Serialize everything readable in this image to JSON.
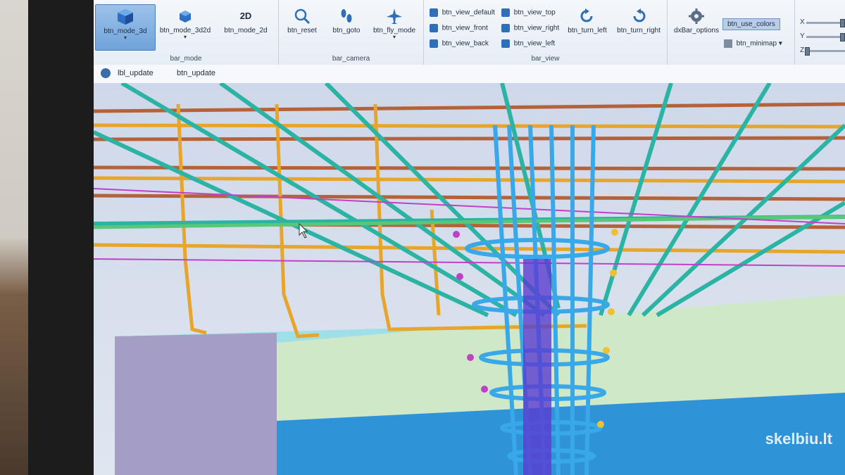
{
  "ribbon": {
    "bar_mode": {
      "label": "bar_mode",
      "buttons": [
        {
          "label": "btn_mode_3d",
          "icon": "cube-icon"
        },
        {
          "label": "btn_mode_3d2d",
          "icon": "cube-small-icon"
        },
        {
          "label": "btn_mode_2d",
          "icon": "2d-icon",
          "icon_text": "2D"
        }
      ]
    },
    "bar_camera": {
      "label": "bar_camera",
      "buttons": [
        {
          "label": "btn_reset",
          "icon": "magnifier-icon"
        },
        {
          "label": "btn_goto",
          "icon": "footprints-icon"
        },
        {
          "label": "btn_fly_mode",
          "icon": "airplane-icon"
        }
      ]
    },
    "bar_view": {
      "label": "bar_view",
      "buttons_left": [
        "btn_view_default",
        "btn_view_front",
        "btn_view_back"
      ],
      "buttons_mid": [
        "btn_view_top",
        "btn_view_right",
        "btn_view_left"
      ],
      "turn_left": "btn_turn_left",
      "turn_right": "btn_turn_right"
    },
    "options": {
      "options_label": "dxBar_options",
      "use_colors": "btn_use_colors",
      "minimap": "btn_minimap"
    },
    "axes": [
      "X",
      "Y",
      "Z"
    ]
  },
  "update_bar": {
    "label": "lbl_update",
    "button": "btn_update"
  },
  "watermark": "skelbiu.lt",
  "colors": {
    "ribbon_bg": "#eaf0f6",
    "rebar_orange": "#e7a52c",
    "rebar_teal": "#2bb3a3",
    "rebar_blue": "#38a8e8",
    "rebar_magenta": "#c040c8",
    "rebar_brown": "#b5623a"
  }
}
